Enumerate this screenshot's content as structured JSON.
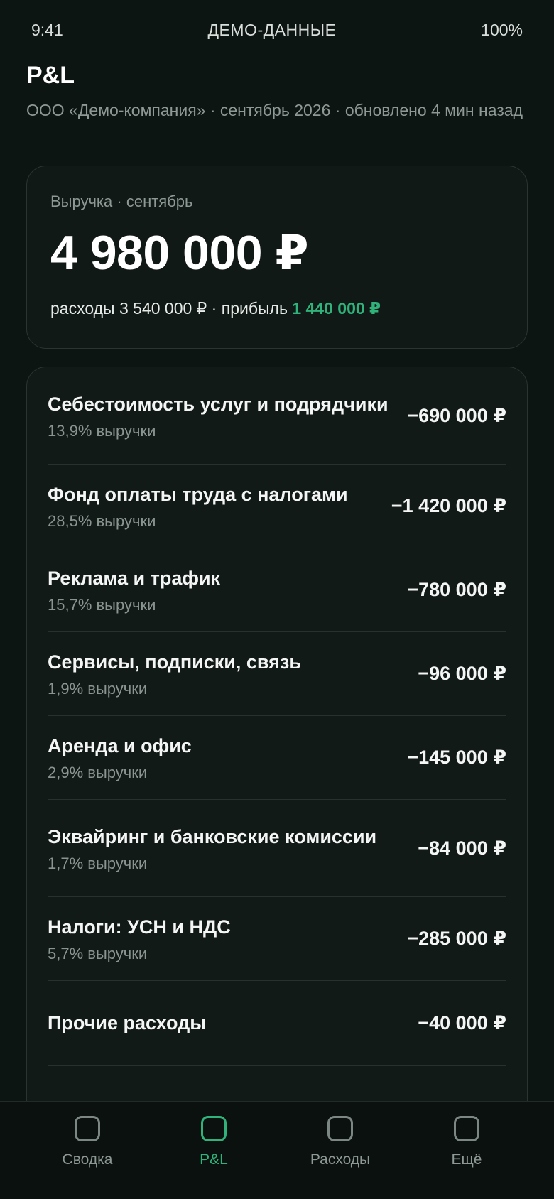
{
  "status_bar": {
    "time": "9:41",
    "center": "ДЕМО-ДАННЫЕ",
    "battery": "100%"
  },
  "header": {
    "title": "P&L",
    "subtitle": "ООО «Демо-компания» · сентябрь 2026 · обновлено 4 мин назад"
  },
  "summary": {
    "label": "Выручка · сентябрь",
    "value": "4 980 000 ₽",
    "expenses_text": "расходы 3 540 000 ₽ · прибыль ",
    "profit": "1 440 000 ₽",
    "profit_color": "#2fb37b"
  },
  "expenses": [
    {
      "title": "Себестоимость услуг и подрядчики",
      "share": "13,9% выручки",
      "amount": "−690 000 ₽"
    },
    {
      "title": "Фонд оплаты труда с налогами",
      "share": "28,5% выручки",
      "amount": "−1 420 000 ₽"
    },
    {
      "title": "Реклама и трафик",
      "share": "15,7% выручки",
      "amount": "−780 000 ₽"
    },
    {
      "title": "Сервисы, подписки, связь",
      "share": "1,9% выручки",
      "amount": "−96 000 ₽"
    },
    {
      "title": "Аренда и офис",
      "share": "2,9% выручки",
      "amount": "−145 000 ₽"
    },
    {
      "title": "Эквайринг и банковские комиссии",
      "share": "1,7% выручки",
      "amount": "−84 000 ₽"
    },
    {
      "title": "Налоги: УСН и НДС",
      "share": "5,7% выручки",
      "amount": "−285 000 ₽"
    },
    {
      "title": "Прочие расходы",
      "share": "",
      "amount": "−40 000 ₽"
    }
  ],
  "tabs": [
    {
      "label": "Сводка",
      "icon": "summary-icon",
      "active": false
    },
    {
      "label": "P&L",
      "icon": "pnl-icon",
      "active": true
    },
    {
      "label": "Расходы",
      "icon": "expenses-icon",
      "active": false
    },
    {
      "label": "Ещё",
      "icon": "more-icon",
      "active": false
    }
  ],
  "colors": {
    "background": "#0d1512",
    "accent": "#2fb37b"
  }
}
